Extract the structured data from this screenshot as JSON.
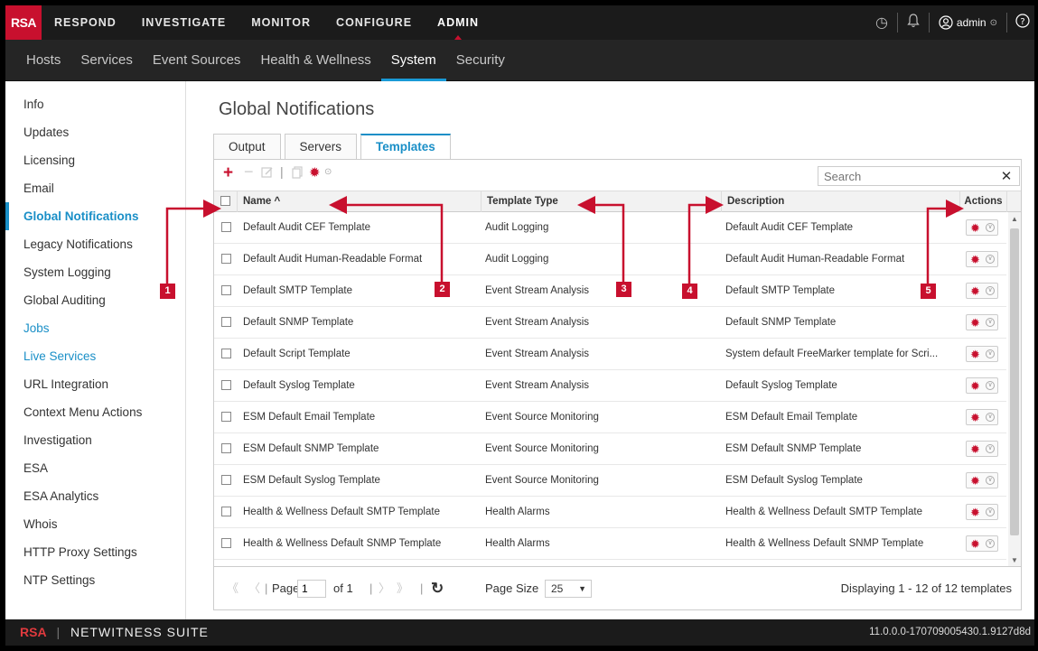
{
  "topbar": {
    "logo": "RSA",
    "nav": [
      "RESPOND",
      "INVESTIGATE",
      "MONITOR",
      "CONFIGURE",
      "ADMIN"
    ],
    "active": "ADMIN",
    "user": "admin"
  },
  "subnav": {
    "items": [
      "Hosts",
      "Services",
      "Event Sources",
      "Health & Wellness",
      "System",
      "Security"
    ],
    "active": "System"
  },
  "sidebar": {
    "items": [
      {
        "label": "Info",
        "state": "normal"
      },
      {
        "label": "Updates",
        "state": "normal"
      },
      {
        "label": "Licensing",
        "state": "normal"
      },
      {
        "label": "Email",
        "state": "normal"
      },
      {
        "label": "Global Notifications",
        "state": "active"
      },
      {
        "label": "Legacy Notifications",
        "state": "normal"
      },
      {
        "label": "System Logging",
        "state": "normal"
      },
      {
        "label": "Global Auditing",
        "state": "normal"
      },
      {
        "label": "Jobs",
        "state": "link"
      },
      {
        "label": "Live Services",
        "state": "link"
      },
      {
        "label": "URL Integration",
        "state": "normal"
      },
      {
        "label": "Context Menu Actions",
        "state": "normal"
      },
      {
        "label": "Investigation",
        "state": "normal"
      },
      {
        "label": "ESA",
        "state": "normal"
      },
      {
        "label": "ESA Analytics",
        "state": "normal"
      },
      {
        "label": "Whois",
        "state": "normal"
      },
      {
        "label": "HTTP Proxy Settings",
        "state": "normal"
      },
      {
        "label": "NTP Settings",
        "state": "normal"
      }
    ]
  },
  "main": {
    "title": "Global Notifications",
    "tabs": [
      "Output",
      "Servers",
      "Templates"
    ],
    "active_tab": "Templates",
    "search_placeholder": "Search",
    "columns": {
      "name": "Name ^",
      "type": "Template Type",
      "description": "Description",
      "actions": "Actions"
    },
    "rows": [
      {
        "name": "Default Audit CEF Template",
        "type": "Audit Logging",
        "description": "Default Audit CEF Template"
      },
      {
        "name": "Default Audit Human-Readable Format",
        "type": "Audit Logging",
        "description": "Default Audit Human-Readable Format"
      },
      {
        "name": "Default SMTP Template",
        "type": "Event Stream Analysis",
        "description": "Default SMTP Template"
      },
      {
        "name": "Default SNMP Template",
        "type": "Event Stream Analysis",
        "description": "Default SNMP Template"
      },
      {
        "name": "Default Script Template",
        "type": "Event Stream Analysis",
        "description": "System default FreeMarker template for Scri..."
      },
      {
        "name": "Default Syslog Template",
        "type": "Event Stream Analysis",
        "description": "Default Syslog Template"
      },
      {
        "name": "ESM Default Email Template",
        "type": "Event Source Monitoring",
        "description": "ESM Default Email Template"
      },
      {
        "name": "ESM Default SNMP Template",
        "type": "Event Source Monitoring",
        "description": "ESM Default SNMP Template"
      },
      {
        "name": "ESM Default Syslog Template",
        "type": "Event Source Monitoring",
        "description": "ESM Default Syslog Template"
      },
      {
        "name": "Health & Wellness Default SMTP Template",
        "type": "Health Alarms",
        "description": "Health & Wellness Default SMTP Template"
      },
      {
        "name": "Health & Wellness Default SNMP Template",
        "type": "Health Alarms",
        "description": "Health & Wellness Default SNMP Template"
      }
    ],
    "pager": {
      "page_label": "Page",
      "page": "1",
      "of": "of 1",
      "page_size_label": "Page Size",
      "page_size": "25",
      "status": "Displaying 1 - 12 of 12 templates"
    }
  },
  "callouts": [
    "1",
    "2",
    "3",
    "4",
    "5"
  ],
  "footer": {
    "brand_logo": "RSA",
    "brand_name": "NETWITNESS SUITE",
    "version": "11.0.0.0-170709005430.1.9127d8d"
  },
  "colors": {
    "accent": "#1a8fc7",
    "brand_red": "#c8102e",
    "topbar": "#1b1b1b",
    "subnav": "#252525"
  }
}
